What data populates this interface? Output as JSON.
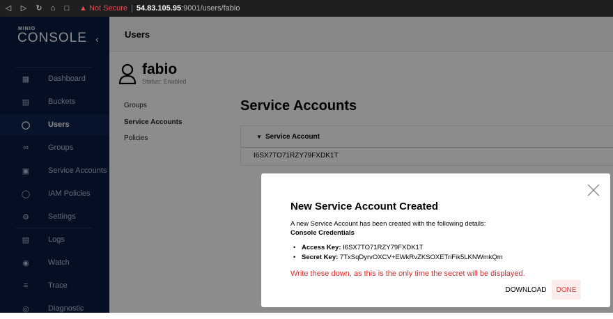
{
  "browser": {
    "not_secure_label": "Not Secure",
    "host": "54.83.105.95",
    "path": ":9001/users/fabio"
  },
  "sidebar": {
    "logo_small": "MINIO",
    "logo_big": "CONSOLE",
    "items": [
      {
        "label": "Dashboard",
        "icon": "dashboard-icon"
      },
      {
        "label": "Buckets",
        "icon": "bucket-icon"
      },
      {
        "label": "Users",
        "icon": "user-icon"
      },
      {
        "label": "Groups",
        "icon": "groups-icon"
      },
      {
        "label": "Service Accounts",
        "icon": "service-accounts-icon"
      },
      {
        "label": "IAM Policies",
        "icon": "shield-icon"
      },
      {
        "label": "Settings",
        "icon": "gear-icon"
      },
      {
        "label": "Logs",
        "icon": "logs-icon"
      },
      {
        "label": "Watch",
        "icon": "watch-icon"
      },
      {
        "label": "Trace",
        "icon": "trace-icon"
      },
      {
        "label": "Diagnostic",
        "icon": "diagnostic-icon"
      }
    ],
    "active_item": "Users"
  },
  "header": {
    "title": "Users"
  },
  "user": {
    "name": "fabio",
    "status": "Status: Enabled"
  },
  "tabs": [
    {
      "label": "Groups"
    },
    {
      "label": "Service Accounts"
    },
    {
      "label": "Policies"
    }
  ],
  "section": {
    "title": "Service Accounts"
  },
  "table": {
    "column": "Service Account",
    "rows": [
      "I6SX7TO71RZY79FXDK1T"
    ]
  },
  "modal": {
    "title": "New Service Account Created",
    "description": "A new Service Account has been created with the following details:",
    "subtitle": "Console Credentials",
    "access_key_label": "Access Key:",
    "access_key_value": "I6SX7TO71RZY79FXDK1T",
    "secret_key_label": "Secret Key:",
    "secret_key_value": "7TxSqDyrvOXCV+EWkRvZKSOXETriFik5LKNWmkQm",
    "warning": "Write these down, as this is the only time the secret will be displayed.",
    "download_label": "DOWNLOAD",
    "done_label": "DONE"
  },
  "colors": {
    "sidebar_bg": "#081c42",
    "warning_red": "#e02b2b",
    "done_bg": "#fdecec"
  }
}
